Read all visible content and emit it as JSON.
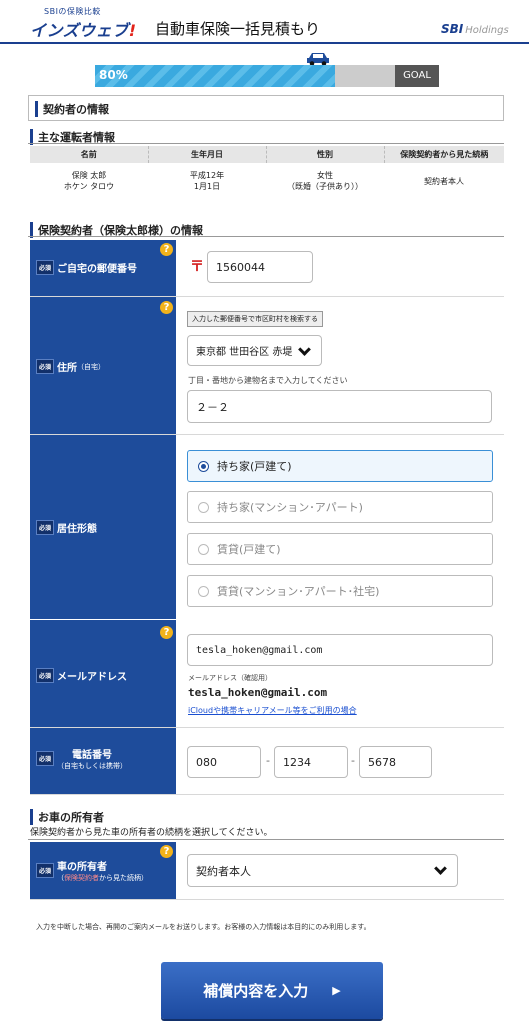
{
  "header": {
    "logo_small": "SBIの保険比較",
    "logo_main": "インズウェブ",
    "logo_bang": "!",
    "title": "自動車保険一括見積もり",
    "sbi_logo": "SBI",
    "sbi_holdings": "Holdings"
  },
  "progress": {
    "percent": 80,
    "label": "80%",
    "goal": "GOAL"
  },
  "contract_section": "契約者の情報",
  "driver": {
    "heading": "主な運転者情報",
    "columns": [
      "名前",
      "生年月日",
      "性別",
      "保険契約者から見た続柄"
    ],
    "name_line1": "保険 太郎",
    "name_line2": "ホケン タロウ",
    "dob_line1": "平成12年",
    "dob_line2": "1月1日",
    "gender_line1": "女性",
    "gender_line2": "（既婚（子供あり））",
    "relation": "契約者本人"
  },
  "holder_heading": "保険契約者（保険太郎様）の情報",
  "required_label": "必須",
  "help_icon": "?",
  "postal": {
    "label": "ご自宅の郵便番号",
    "mark": "〒",
    "value": "1560044"
  },
  "address": {
    "label": "住所",
    "label_sub": "（自宅）",
    "search_button": "入力した郵便番号で市区町村を検索する",
    "city_value": "東京都 世田谷区 赤堤",
    "hint": "丁目・番地から建物名まで入力してください",
    "street_value": "２－２"
  },
  "residence": {
    "label": "居住形態",
    "options": [
      "持ち家(戸建て)",
      "持ち家(マンション･アパート)",
      "賃貸(戸建て)",
      "賃貸(マンション･アパート･社宅)"
    ],
    "selected": "持ち家(戸建て)"
  },
  "email": {
    "label": "メールアドレス",
    "value": "tesla_hoken@gmail.com",
    "confirm_caption": "メールアドレス（確認用）",
    "confirm_value": "tesla_hoken@gmail.com",
    "link": "iCloudや携帯キャリアメール等をご利用の場合"
  },
  "phone": {
    "label": "電話番号",
    "label_sub": "（自宅もしくは携帯）",
    "part1": "080",
    "part2": "1234",
    "part3": "5678",
    "sep": "-"
  },
  "owner": {
    "heading": "お車の所有者",
    "description": "保険契約者から見た車の所有者の続柄を選択してください。",
    "label": "車の所有者",
    "sub_open": "（",
    "sub_red": "保険契約者",
    "sub_rest": "から見た続柄）",
    "value": "契約者本人"
  },
  "notice": "入力を中断した場合、再開のご案内メールをお送りします。お客様の入力情報は本目的にのみ利用します。",
  "submit": {
    "label": "補償内容を入力",
    "arrow": "▶"
  },
  "colors": {
    "accent": "#1e4c9b",
    "progress": "#3aa9df",
    "help": "#f2b21b"
  }
}
